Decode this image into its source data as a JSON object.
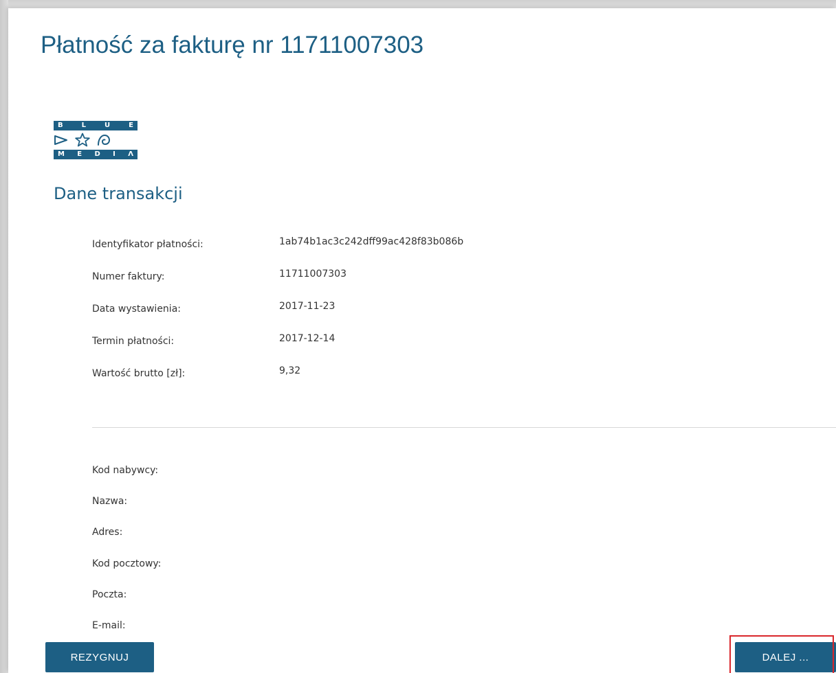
{
  "page": {
    "title": "Płatność za fakturę nr 11711007303"
  },
  "logo": {
    "top_letters": [
      "B",
      "L",
      "U",
      "E"
    ],
    "bottom_letters": [
      "M",
      "E",
      "D",
      "I",
      "Λ"
    ],
    "icons": [
      "play-triangle-icon",
      "star-icon",
      "spiral-icon"
    ],
    "color": "#1d5f84"
  },
  "transaction": {
    "heading": "Dane transakcji",
    "payment_id_label": "Identyfikator płatności:",
    "payment_id_value": "1ab74b1ac3c242dff99ac428f83b086b",
    "invoice_number_label": "Numer faktury:",
    "invoice_number_value": "11711007303",
    "issue_date_label": "Data wystawienia:",
    "issue_date_value": "2017-11-23",
    "due_date_label": "Termin płatności:",
    "due_date_value": "2017-12-14",
    "gross_value_label": "Wartość brutto [zł]:",
    "gross_value_value": "9,32"
  },
  "buyer": {
    "code_label": "Kod nabywcy:",
    "name_label": "Nazwa:",
    "address_label": "Adres:",
    "postal_code_label": "Kod pocztowy:",
    "post_office_label": "Poczta:",
    "email_label": "E-mail:"
  },
  "actions": {
    "cancel_label": "REZYGNUJ",
    "next_label": "DALEJ ..."
  },
  "colors": {
    "accent": "#1d5f84",
    "highlight": "#d9262b"
  }
}
